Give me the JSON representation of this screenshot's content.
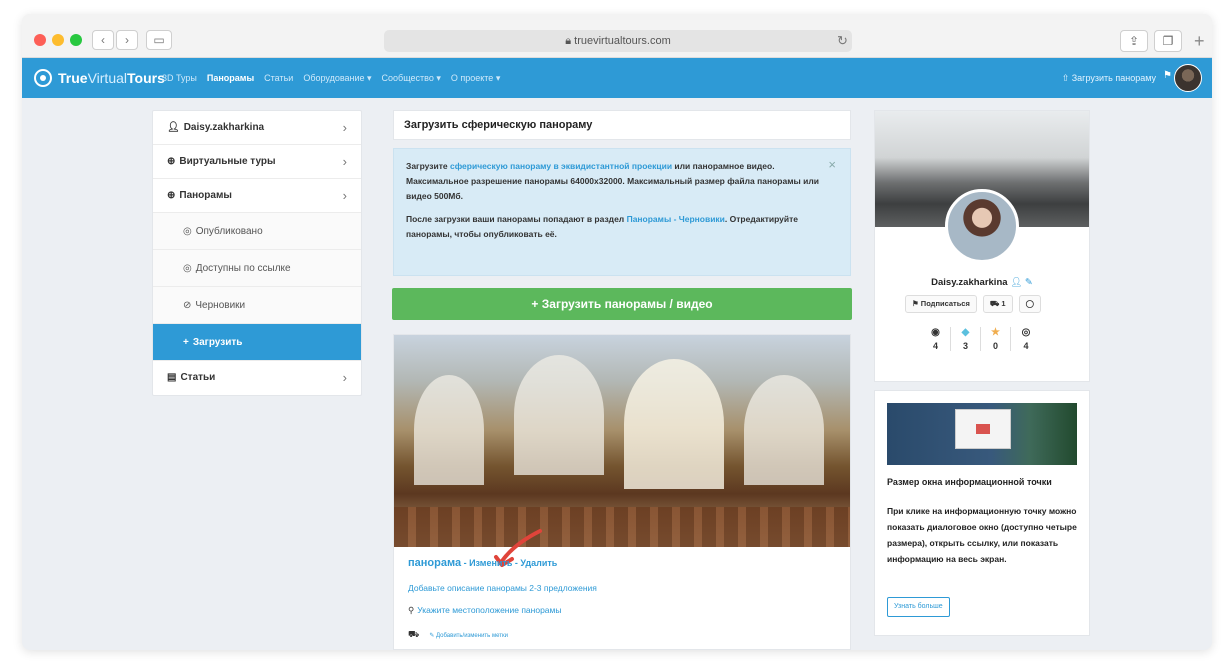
{
  "browser": {
    "url": "truevirtualtours.com",
    "colors": {
      "close": "#fd5f57",
      "minimize": "#fdbc2e",
      "zoom": "#28c840"
    }
  },
  "nav": {
    "brand_bold": "True",
    "brand_light": "Virtual",
    "brand_end": "Tours",
    "items": [
      "3D Туры",
      "Панорамы",
      "Статьи",
      "Оборудование ▾",
      "Сообщество ▾",
      "О проекте ▾"
    ],
    "active_index": 1,
    "upload": "⇧ Загрузить панораму",
    "accent": "#2e9ad6"
  },
  "sidebar": {
    "user": "Daisy.zakharkina",
    "virtual_tours": "Виртуальные туры",
    "panoramas": "Панорамы",
    "published": "Опубликовано",
    "by_link": "Доступны по ссылке",
    "drafts": "Черновики",
    "upload": "Загрузить",
    "articles": "Статьи"
  },
  "main": {
    "title": "Загрузить сферическую панораму",
    "info_1a": "Загрузите ",
    "info_1_link": "сферическую панораму в эквидистантной проекции",
    "info_1b": " или панорамное видео. Максимальное разрешение панорамы 64000x32000. Максимальный размер файла панорамы или видео 500Мб.",
    "info_2a": "После загрузки ваши панорамы попадают в раздел ",
    "info_2_link": "Панорамы - Черновики",
    "info_2b": ". Отредактируйте панорамы, чтобы опубликовать её.",
    "upload_button": "+ Загрузить панорамы / видео",
    "pano_name": "панорама",
    "edit": "Изменить",
    "delete": "Удалить",
    "sep": " - ",
    "add_desc": "Добавьте описание панорамы 2-3 предложения",
    "location": "Укажите местоположение панорамы",
    "tags": "✎ Добавить/изменить метки"
  },
  "profile": {
    "name": "Daisy.zakharkina",
    "subscribe": "⚑ Подписаться",
    "followers": "1",
    "stats": [
      {
        "icon": "camera-icon",
        "glyph": "◉",
        "value": "4"
      },
      {
        "icon": "diamond-icon",
        "glyph": "◆",
        "value": "3"
      },
      {
        "icon": "star-icon",
        "glyph": "★",
        "value": "0"
      },
      {
        "icon": "eye-icon",
        "glyph": "◎",
        "value": "4"
      }
    ]
  },
  "tip": {
    "title": "Размер окна информационной точки",
    "text": "При клике на информационную точку можно показать диалоговое окно (доступно четыре размера), открыть ссылку, или показать информацию на весь экран.",
    "button": "Узнать больше"
  }
}
